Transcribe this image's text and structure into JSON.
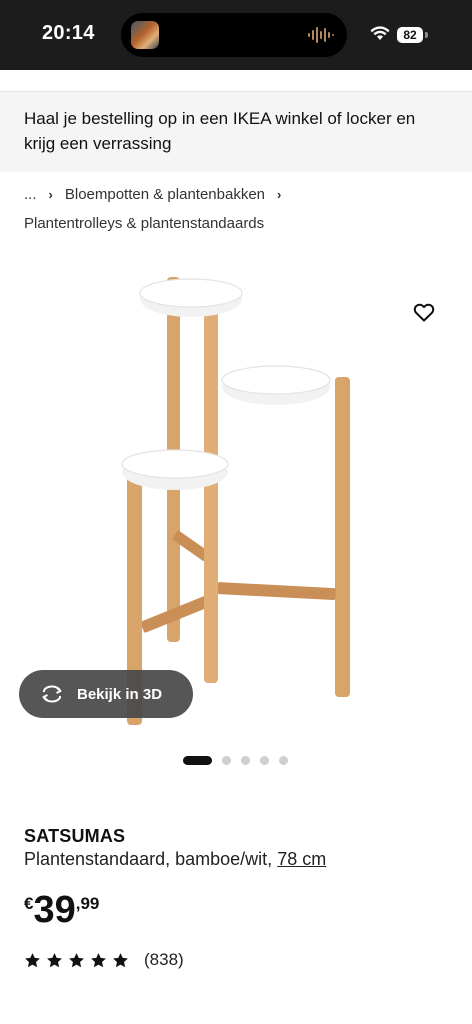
{
  "status_bar": {
    "time": "20:14",
    "battery": "82"
  },
  "banner": {
    "text": "Haal je bestelling op in een IKEA winkel of locker en krijg een verrassing"
  },
  "breadcrumb": {
    "ellipsis": "...",
    "category": "Bloempotten & plantenbakken",
    "subcategory": "Plantentrolleys & plantenstandaards"
  },
  "gallery": {
    "view_3d_label": "Bekijk in 3D",
    "image_count": 5,
    "active_index": 0
  },
  "product": {
    "brand": "SATSUMAS",
    "description": "Plantenstandaard, bamboe/wit,",
    "size_link": "78 cm",
    "price": {
      "currency": "€",
      "integer": "39",
      "decimal": ",99"
    },
    "rating": {
      "stars": 5,
      "count": "(838)"
    }
  },
  "colors": {
    "status_bar_bg": "#1c1c1c",
    "banner_bg": "#f5f5f5",
    "bamboo": "#d9a46a",
    "text": "#111111"
  }
}
